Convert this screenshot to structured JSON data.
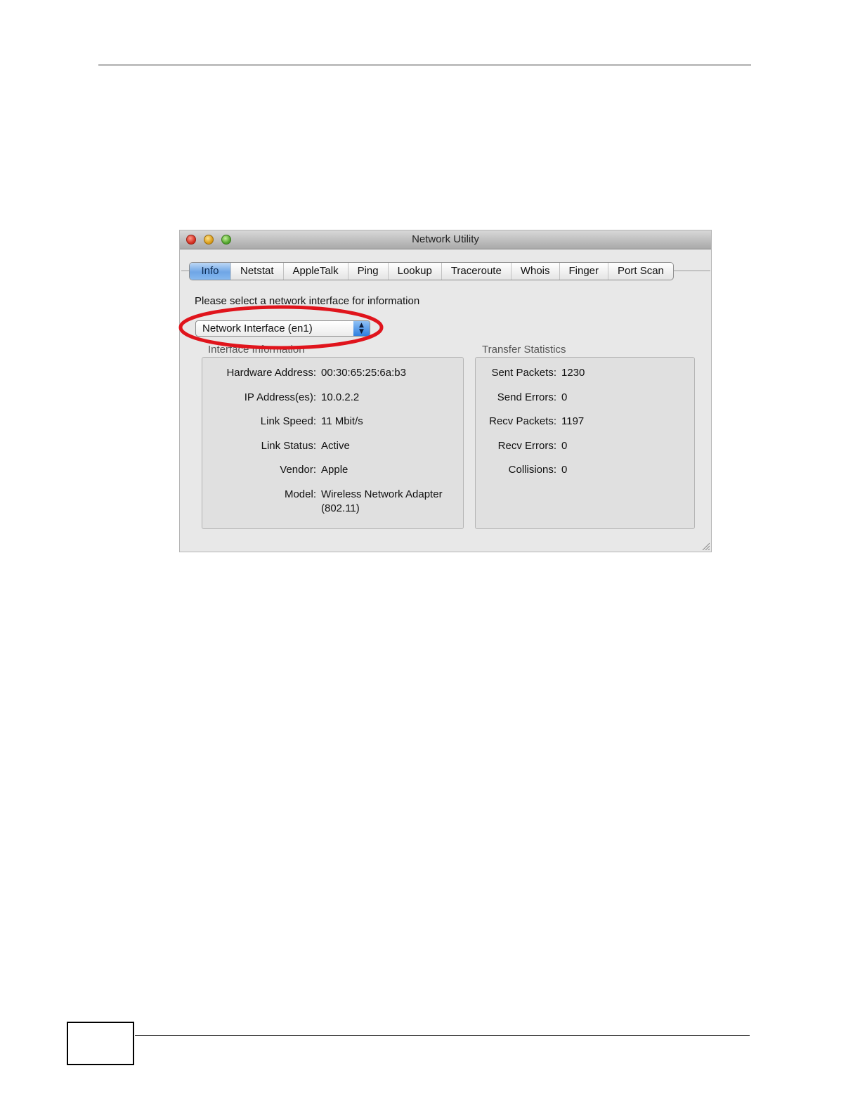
{
  "window": {
    "title": "Network Utility"
  },
  "tabs": [
    "Info",
    "Netstat",
    "AppleTalk",
    "Ping",
    "Lookup",
    "Traceroute",
    "Whois",
    "Finger",
    "Port Scan"
  ],
  "prompt": "Please select a network interface for information",
  "interface_select": {
    "value": "Network Interface (en1)"
  },
  "interface_info": {
    "title": "Interface Information",
    "rows": [
      {
        "label": "Hardware Address:",
        "value": "00:30:65:25:6a:b3"
      },
      {
        "label": "IP Address(es):",
        "value": "10.0.2.2"
      },
      {
        "label": "Link Speed:",
        "value": "11 Mbit/s"
      },
      {
        "label": "Link Status:",
        "value": "Active"
      },
      {
        "label": "Vendor:",
        "value": "Apple"
      },
      {
        "label": "Model:",
        "value": "Wireless Network Adapter",
        "value2": "(802.11)"
      }
    ]
  },
  "transfer_stats": {
    "title": "Transfer Statistics",
    "rows": [
      {
        "label": "Sent Packets:",
        "value": "1230"
      },
      {
        "label": "Send Errors:",
        "value": "0"
      },
      {
        "label": "Recv Packets:",
        "value": "1197"
      },
      {
        "label": "Recv Errors:",
        "value": "0"
      },
      {
        "label": "Collisions:",
        "value": "0"
      }
    ]
  },
  "colors": {
    "highlight_ring": "#e0141c",
    "active_tab": "#6fa6e6"
  }
}
